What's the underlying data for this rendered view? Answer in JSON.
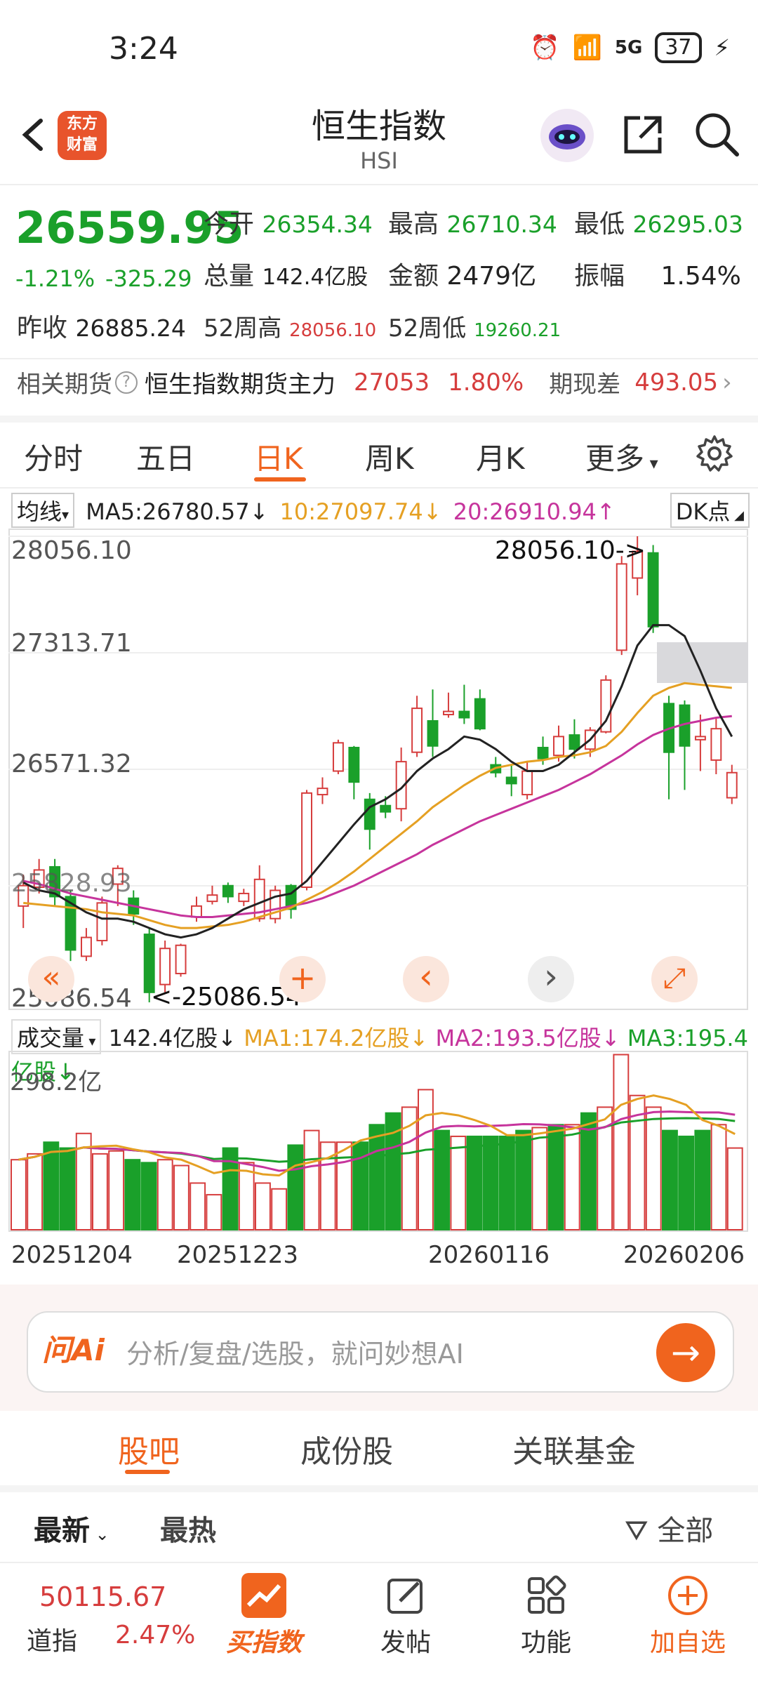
{
  "status_bar": {
    "time": "3:24",
    "battery": "37",
    "network": "5G"
  },
  "header": {
    "title": "恒生指数",
    "subtitle": "HSI",
    "logo_text": "东方\n财富"
  },
  "quote": {
    "price": "26559.95",
    "change_pct": "-1.21%",
    "change": "-325.29",
    "prev_close_label": "昨收",
    "prev_close": "26885.24",
    "open_label": "今开",
    "open": "26354.34",
    "high_label": "最高",
    "high": "26710.34",
    "low_label": "最低",
    "low": "26295.03",
    "volume_label": "总量",
    "volume": "142.4亿股",
    "amount_label": "金额",
    "amount": "2479亿",
    "amplitude_label": "振幅",
    "amplitude": "1.54%",
    "w52_high_label": "52周高",
    "w52_high": "28056.10",
    "w52_low_label": "52周低",
    "w52_low": "19260.21"
  },
  "futures": {
    "label": "相关期货",
    "name": "恒生指数期货主力",
    "price": "27053",
    "pct": "1.80%",
    "basis_label": "期现差",
    "basis": "493.05"
  },
  "tabs": [
    "分时",
    "五日",
    "日K",
    "周K",
    "月K",
    "更多"
  ],
  "active_tab": "日K",
  "ma": {
    "selector": "均线",
    "ma5": "MA5:26780.57↓",
    "ma10": "10:27097.74↓",
    "ma20": "20:26910.94↑",
    "dk": "DK点"
  },
  "chart_data": {
    "type": "candlestick",
    "y_labels": [
      "28056.10",
      "27313.71",
      "26571.32",
      "25828.93",
      "25086.54"
    ],
    "max_annotation": "28056.10->",
    "min_annotation": "<-25086.54",
    "ylim": [
      25086.54,
      28056.1
    ],
    "candles": [
      {
        "o": 25700,
        "c": 25830,
        "h": 25900,
        "l": 25560
      },
      {
        "o": 25820,
        "c": 25930,
        "h": 26000,
        "l": 25780
      },
      {
        "o": 25950,
        "c": 25760,
        "h": 26000,
        "l": 25700
      },
      {
        "o": 25760,
        "c": 25420,
        "h": 25800,
        "l": 25350
      },
      {
        "o": 25380,
        "c": 25500,
        "h": 25560,
        "l": 25350
      },
      {
        "o": 25480,
        "c": 25720,
        "h": 25760,
        "l": 25450
      },
      {
        "o": 25840,
        "c": 25940,
        "h": 25960,
        "l": 25700
      },
      {
        "o": 25750,
        "c": 25650,
        "h": 25800,
        "l": 25580
      },
      {
        "o": 25520,
        "c": 25150,
        "h": 25560,
        "l": 25086.54
      },
      {
        "o": 25200,
        "c": 25430,
        "h": 25480,
        "l": 25150
      },
      {
        "o": 25270,
        "c": 25450,
        "h": 25460,
        "l": 25250
      },
      {
        "o": 25630,
        "c": 25700,
        "h": 25760,
        "l": 25600
      },
      {
        "o": 25730,
        "c": 25770,
        "h": 25830,
        "l": 25710
      },
      {
        "o": 25830,
        "c": 25760,
        "h": 25850,
        "l": 25720
      },
      {
        "o": 25730,
        "c": 25780,
        "h": 25810,
        "l": 25700
      },
      {
        "o": 25620,
        "c": 25870,
        "h": 25960,
        "l": 25600
      },
      {
        "o": 25620,
        "c": 25800,
        "h": 25830,
        "l": 25590
      },
      {
        "o": 25830,
        "c": 25680,
        "h": 25840,
        "l": 25620
      },
      {
        "o": 25820,
        "c": 26420,
        "h": 26440,
        "l": 25800
      },
      {
        "o": 26410,
        "c": 26450,
        "h": 26520,
        "l": 26350
      },
      {
        "o": 26560,
        "c": 26740,
        "h": 26760,
        "l": 26540
      },
      {
        "o": 26710,
        "c": 26490,
        "h": 26720,
        "l": 26380
      },
      {
        "o": 26380,
        "c": 26190,
        "h": 26420,
        "l": 26060
      },
      {
        "o": 26340,
        "c": 26300,
        "h": 26400,
        "l": 26260
      },
      {
        "o": 26320,
        "c": 26620,
        "h": 26710,
        "l": 26240
      },
      {
        "o": 26680,
        "c": 26960,
        "h": 27040,
        "l": 26650
      },
      {
        "o": 26880,
        "c": 26720,
        "h": 27080,
        "l": 26650
      },
      {
        "o": 26920,
        "c": 26940,
        "h": 27060,
        "l": 26900
      },
      {
        "o": 26940,
        "c": 26900,
        "h": 27110,
        "l": 26860
      },
      {
        "o": 27020,
        "c": 26830,
        "h": 27080,
        "l": 26820
      },
      {
        "o": 26600,
        "c": 26550,
        "h": 26650,
        "l": 26520
      },
      {
        "o": 26520,
        "c": 26480,
        "h": 26600,
        "l": 26400
      },
      {
        "o": 26410,
        "c": 26560,
        "h": 26620,
        "l": 26380
      },
      {
        "o": 26710,
        "c": 26640,
        "h": 26780,
        "l": 26600
      },
      {
        "o": 26660,
        "c": 26780,
        "h": 26850,
        "l": 26620
      },
      {
        "o": 26790,
        "c": 26700,
        "h": 26890,
        "l": 26640
      },
      {
        "o": 26700,
        "c": 26820,
        "h": 26840,
        "l": 26650
      },
      {
        "o": 26810,
        "c": 27140,
        "h": 27170,
        "l": 26800
      },
      {
        "o": 27330,
        "c": 27880,
        "h": 27930,
        "l": 27300
      },
      {
        "o": 27790,
        "c": 27960,
        "h": 28056.1,
        "l": 27680
      },
      {
        "o": 27950,
        "c": 27480,
        "h": 28000,
        "l": 27440
      },
      {
        "o": 26990,
        "c": 26680,
        "h": 27040,
        "l": 26380
      },
      {
        "o": 26980,
        "c": 26720,
        "h": 27010,
        "l": 26440
      },
      {
        "o": 26760,
        "c": 26780,
        "h": 26920,
        "l": 26560
      },
      {
        "o": 26630,
        "c": 26830,
        "h": 26900,
        "l": 26540
      },
      {
        "o": 26390,
        "c": 26550,
        "h": 26600,
        "l": 26350
      }
    ],
    "ma5": [
      25850,
      25800,
      25780,
      25720,
      25660,
      25620,
      25620,
      25600,
      25560,
      25520,
      25500,
      25520,
      25560,
      25620,
      25680,
      25720,
      25760,
      25780,
      25860,
      25980,
      26100,
      26220,
      26330,
      26380,
      26450,
      26560,
      26640,
      26700,
      26780,
      26760,
      26700,
      26620,
      26560,
      26560,
      26600,
      26680,
      26760,
      26880,
      27100,
      27360,
      27490,
      27490,
      27420,
      27200,
      26960,
      26780
    ],
    "ma10": [
      25720,
      25710,
      25700,
      25690,
      25680,
      25660,
      25650,
      25640,
      25610,
      25580,
      25560,
      25560,
      25570,
      25580,
      25600,
      25630,
      25660,
      25690,
      25740,
      25790,
      25850,
      25920,
      26000,
      26080,
      26160,
      26240,
      26330,
      26400,
      26470,
      26530,
      26580,
      26600,
      26620,
      26630,
      26650,
      26660,
      26680,
      26720,
      26810,
      26930,
      27040,
      27090,
      27120,
      27110,
      27100,
      27090
    ],
    "ma20": [
      25860,
      25840,
      25810,
      25780,
      25760,
      25740,
      25720,
      25700,
      25680,
      25660,
      25640,
      25630,
      25630,
      25640,
      25650,
      25660,
      25680,
      25700,
      25720,
      25750,
      25790,
      25830,
      25880,
      25930,
      25980,
      26030,
      26090,
      26140,
      26190,
      26240,
      26280,
      26320,
      26360,
      26400,
      26440,
      26490,
      26540,
      26600,
      26660,
      26730,
      26790,
      26830,
      26860,
      26880,
      26900,
      26910
    ]
  },
  "chart_controls": [
    "«",
    "+",
    "‹",
    "›",
    "⤢"
  ],
  "volume": {
    "selector": "成交量",
    "value": "142.4亿股↓",
    "ma1": "MA1:174.2亿股↓",
    "ma2": "MA2:193.5亿股↓",
    "ma3": "MA3:195.4亿股↓",
    "max_label": "298.2亿",
    "values": [
      120,
      130,
      150,
      140,
      165,
      130,
      135,
      120,
      115,
      120,
      110,
      80,
      60,
      140,
      115,
      80,
      70,
      145,
      170,
      150,
      150,
      150,
      180,
      200,
      210,
      240,
      170,
      160,
      160,
      160,
      160,
      170,
      175,
      180,
      180,
      200,
      210,
      300,
      230,
      210,
      170,
      160,
      170,
      180,
      140
    ],
    "dates": [
      "20251204",
      "20251223",
      "20260116",
      "20260206"
    ]
  },
  "ai_bar": {
    "logo": "问Ai",
    "placeholder": "分析/复盘/选股，就问妙想AI"
  },
  "bottom_tabs": [
    "股吧",
    "成份股",
    "关联基金"
  ],
  "sorts": {
    "latest": "最新",
    "hot": "最热",
    "filter": "全部"
  },
  "nav": {
    "dji_value": "50115.67",
    "dji_label": "道指",
    "dji_pct": "2.47%",
    "buy": "买指数",
    "post": "发帖",
    "func": "功能",
    "add": "加自选"
  },
  "colors": {
    "up": "#d63d3d",
    "down": "#1aa02a",
    "accent": "#f0641e",
    "ma5": "#222222",
    "ma10": "#e5a023",
    "ma20": "#c6349c"
  }
}
